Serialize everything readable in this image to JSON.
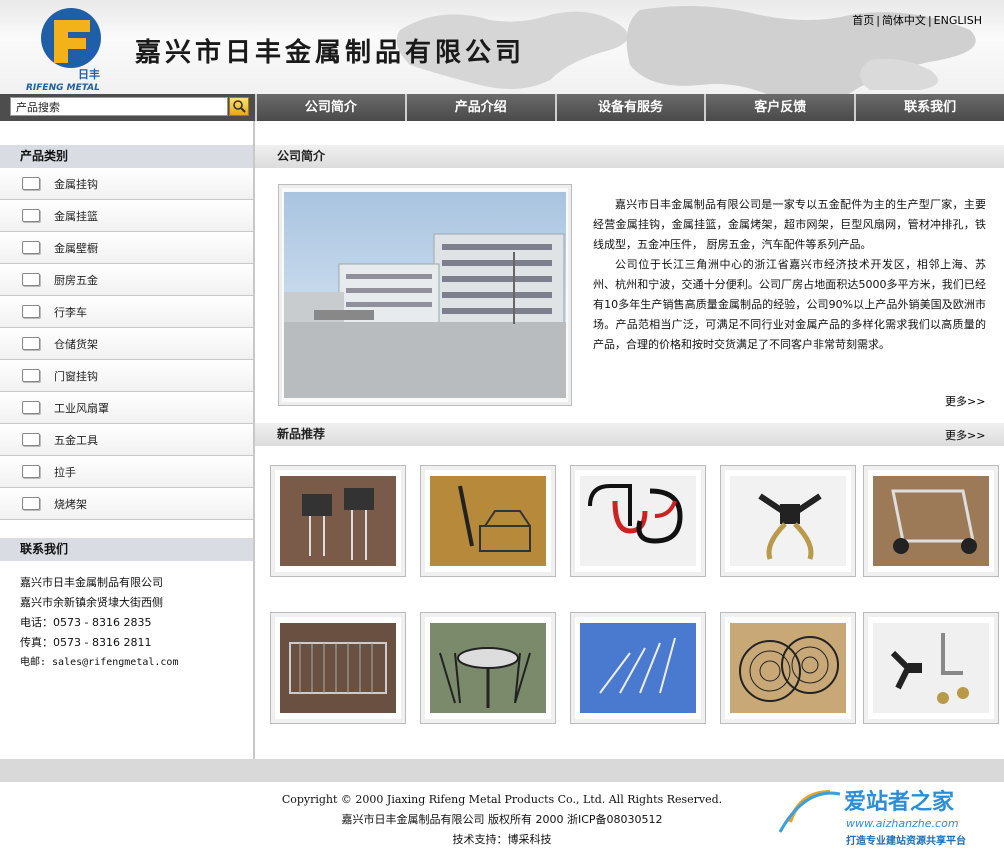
{
  "header": {
    "company_name": "嘉兴市日丰金属制品有限公司",
    "logo_text": "日丰",
    "logo_subtext": "RIFENG METAL",
    "links": [
      "首页",
      "简体中文",
      "ENGLISH"
    ],
    "link_separator": "|"
  },
  "search": {
    "placeholder": "产品搜索"
  },
  "nav": [
    "公司简介",
    "产品介绍",
    "设备有服务",
    "客户反馈",
    "联系我们"
  ],
  "sidebar": {
    "category_title": "产品类别",
    "categories": [
      "金属挂钩",
      "金属挂篮",
      "金属壁橱",
      "厨房五金",
      "行李车",
      "仓储货架",
      "门窗挂钩",
      "工业风扇罩",
      "五金工具",
      "拉手",
      "烧烤架"
    ],
    "contact_title": "联系我们",
    "contact_lines": [
      "嘉兴市日丰金属制品有限公司",
      "嘉兴市余新镇余贤埭大街西侧",
      "电话：0573 - 8316 2835",
      "传真：0573 - 8316 2811",
      "电邮: sales@rifengmetal.com"
    ]
  },
  "about": {
    "title": "公司简介",
    "paragraph1": "嘉兴市日丰金属制品有限公司是一家专以五金配件为主的生产型厂家，主要经营金属挂钩，金属挂篮，金属烤架，超市网架，巨型风扇网，管材冲排孔，铁线成型，五金冲压件， 厨房五金，汽车配件等系列产品。",
    "paragraph2": "公司位于长江三角洲中心的浙江省嘉兴市经济技术开发区，相邻上海、苏州、杭州和宁波，交通十分便利。公司厂房占地面积达5000多平方米，我们已经有10多年生产销售高质量金属制品的经验，公司90%以上产品外销美国及欧洲市场。产品范相当广泛，可满足不同行业对金属产品的多样化需求我们以高质量的产品，合理的价格和按时交货满足了不同客户非常苛刻需求。",
    "more": "更多>>"
  },
  "new_products": {
    "title": "新品推荐",
    "more": "更多>>"
  },
  "footer": {
    "copyright": "Copyright © 2000 Jiaxing Rifeng Metal Products Co., Ltd.  All Rights Reserved.",
    "line2": "嘉兴市日丰金属制品有限公司 版权所有 2000  浙ICP备08030512",
    "line3": "技术支持：博采科技"
  },
  "watermark": {
    "title": "爱站者之家",
    "url": "www.aizhanzhe.com",
    "slogan": "打造专业建站资源共享平台"
  },
  "colors": {
    "nav_bg": "#4f4f4f",
    "section_bg": "#d9dde3",
    "logo_blue": "#1f5fa8",
    "logo_yellow": "#f3b21a"
  }
}
